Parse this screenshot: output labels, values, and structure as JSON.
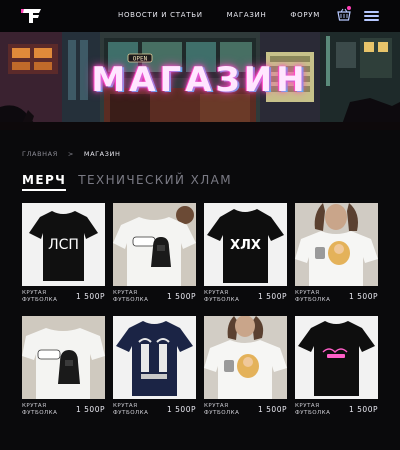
{
  "brand": {
    "logo": "logo-icon",
    "accent": "#ff3fb5",
    "cyan": "#27d3ff"
  },
  "nav": {
    "items": [
      {
        "label": "НОВОСТИ И СТАТЬИ"
      },
      {
        "label": "МАГАЗИН"
      },
      {
        "label": "ФОРУМ"
      }
    ]
  },
  "icons": {
    "cart": "cart-icon",
    "menu": "hamburger-icon"
  },
  "hero": {
    "title": "МАГАЗИН",
    "sign": "OPEN"
  },
  "breadcrumb": {
    "home": "ГЛАВНАЯ",
    "separator": ">",
    "current": "МАГАЗИН"
  },
  "tabs": [
    {
      "label": "МЕРЧ",
      "active": true
    },
    {
      "label": "ТЕХНИЧЕСКИЙ ХЛАМ",
      "active": false
    }
  ],
  "products": [
    {
      "name_line1": "КРУТАЯ",
      "name_line2": "ФУТБОЛКА",
      "price": "1 500Р",
      "print": "ЛСП"
    },
    {
      "name_line1": "КРУТАЯ",
      "name_line2": "ФУТБОЛКА",
      "price": "1 500Р"
    },
    {
      "name_line1": "КРУТАЯ",
      "name_line2": "ФУТБОЛКА",
      "price": "1 500Р",
      "print": "ХЛХ"
    },
    {
      "name_line1": "КРУТАЯ",
      "name_line2": "ФУТБОЛКА",
      "price": "1 500Р"
    },
    {
      "name_line1": "КРУТАЯ",
      "name_line2": "ФУТБОЛКА",
      "price": "1 500Р"
    },
    {
      "name_line1": "КРУТАЯ",
      "name_line2": "ФУТБОЛКА",
      "price": "1 500Р"
    },
    {
      "name_line1": "КРУТАЯ",
      "name_line2": "ФУТБОЛКА",
      "price": "1 500Р"
    },
    {
      "name_line1": "КРУТАЯ",
      "name_line2": "ФУТБОЛКА",
      "price": "1 500Р"
    }
  ]
}
